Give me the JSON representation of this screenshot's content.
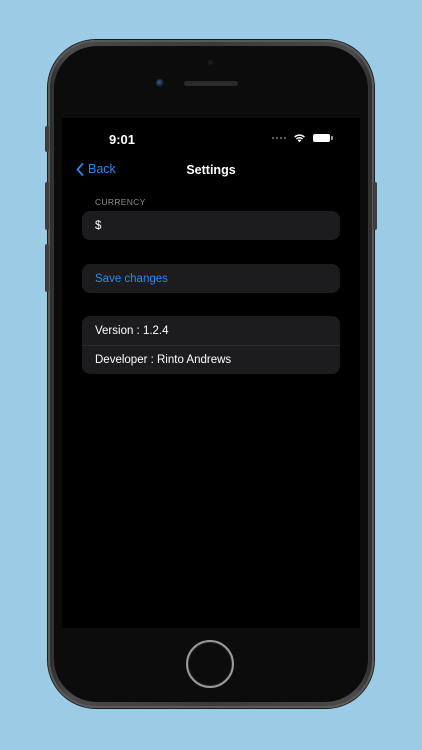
{
  "status_bar": {
    "time": "9:01"
  },
  "nav": {
    "back_label": "Back",
    "title": "Settings"
  },
  "currency": {
    "header": "CURRENCY",
    "value": "$"
  },
  "actions": {
    "save_label": "Save changes"
  },
  "info": {
    "version": "Version : 1.2.4",
    "developer": "Developer : Rinto Andrews"
  },
  "colors": {
    "background": "#9ccbe6",
    "accent": "#2f87e8",
    "card": "#1c1c1e",
    "screen": "#000000"
  },
  "icons": {
    "back": "chevron-left-icon",
    "wifi": "wifi-icon",
    "battery": "battery-icon",
    "cellular": "cellular-dots-icon"
  }
}
